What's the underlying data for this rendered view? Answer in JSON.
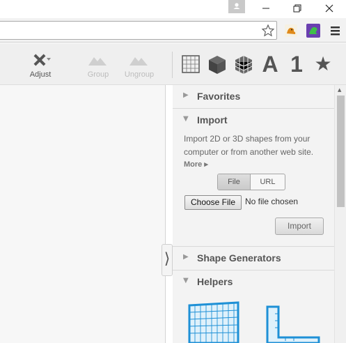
{
  "toolbar": {
    "adjust_label": "Adjust",
    "group_label": "Group",
    "ungroup_label": "Ungroup",
    "category_text_glyph": "A",
    "category_number_glyph": "1",
    "category_favorites_glyph": "★"
  },
  "canvas": {
    "collapse_glyph": "⟩"
  },
  "panel": {
    "favorites": {
      "arrow": "▶",
      "label": "Favorites"
    },
    "import": {
      "arrow": "▼",
      "label": "Import",
      "description": "Import 2D or 3D shapes from your computer or from another web site.",
      "more_link": "More ▸",
      "tab_file": "File",
      "tab_url": "URL",
      "choose_file": "Choose File",
      "no_file": "No file chosen",
      "import_button": "Import"
    },
    "shape_generators": {
      "arrow": "▶",
      "label": "Shape Generators"
    },
    "helpers": {
      "arrow": "▼",
      "label": "Helpers"
    }
  },
  "colors": {
    "helper_blue": "#1e90d6",
    "panel_bg": "#f3f3f3",
    "toolbar_bg": "#efefef"
  }
}
